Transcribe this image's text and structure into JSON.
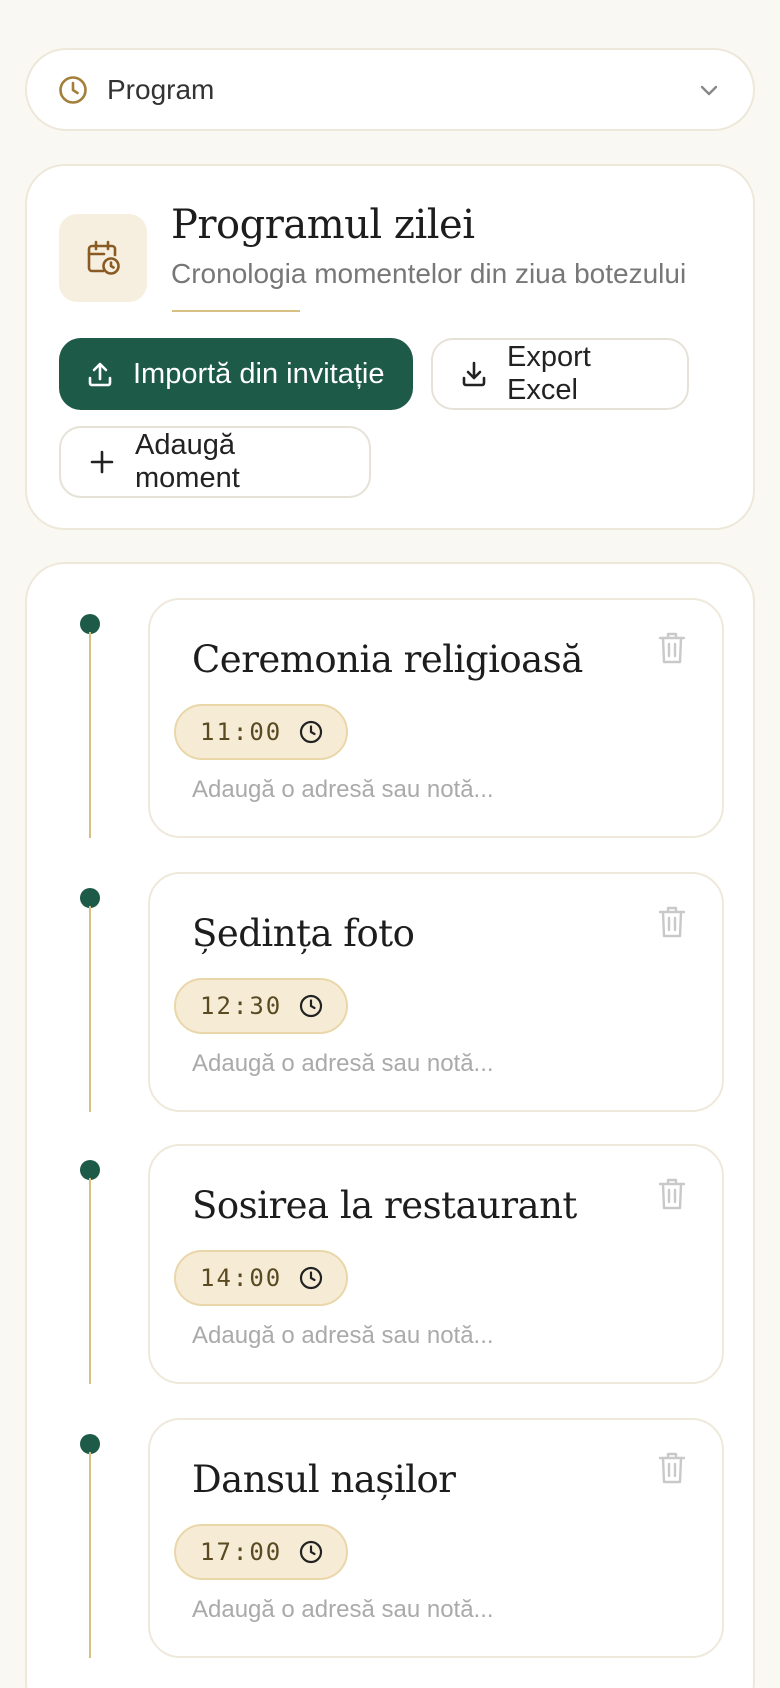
{
  "section_select": {
    "label": "Program",
    "icon": "clock-icon",
    "chevron": "chevron-down-icon"
  },
  "header": {
    "title": "Programul zilei",
    "subtitle": "Cronologia momentelor din ziua botezului",
    "icon": "calendar-clock-icon",
    "buttons": {
      "import": "Importă din invitație",
      "export": "Export Excel",
      "add": "Adaugă moment"
    }
  },
  "moments": [
    {
      "title": "Ceremonia religioasă",
      "time": "11:00",
      "note_placeholder": "Adaugă o adresă sau notă..."
    },
    {
      "title": "Ședința foto",
      "time": "12:30",
      "note_placeholder": "Adaugă o adresă sau notă..."
    },
    {
      "title": "Sosirea la restaurant",
      "time": "14:00",
      "note_placeholder": "Adaugă o adresă sau notă..."
    },
    {
      "title": "Dansul nașilor",
      "time": "17:00",
      "note_placeholder": "Adaugă o adresă sau notă..."
    }
  ],
  "colors": {
    "accent_green": "#1e5a48",
    "accent_gold": "#d8bf84",
    "background": "#faf8f2",
    "time_pill": "#f6ecd6"
  }
}
